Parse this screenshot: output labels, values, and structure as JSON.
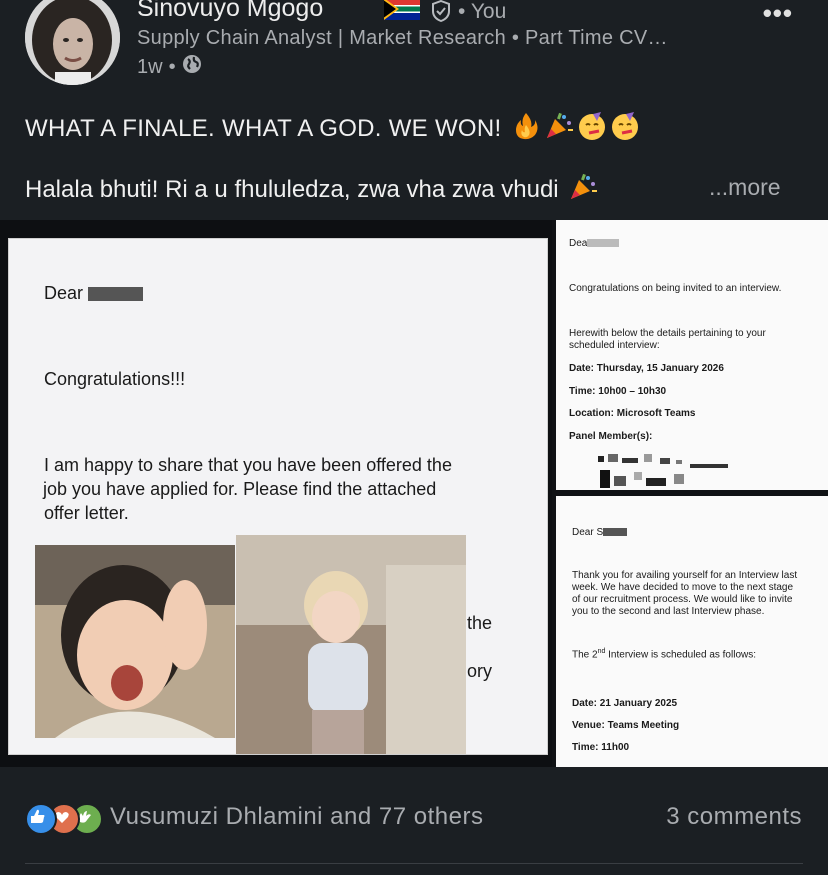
{
  "author": {
    "name": "Sinovuyo Mgogo",
    "you_label": "You",
    "headline": "Supply Chain Analyst | Market Research • Part Time CV…",
    "time": "1w",
    "visibility_icon": "globe-icon",
    "flag_icon": "south-africa-flag-icon"
  },
  "menu_label": "•••",
  "post": {
    "line1": "WHAT A FINALE. WHAT A GOD. WE WON!",
    "line2": "Halala bhuti! Ri a u fhululedza, zwa vha zwa vhudi",
    "more": "...more"
  },
  "media": {
    "left": {
      "dear": "Dear",
      "congrats": "Congratulations!!!",
      "body1": "I am happy to share that you have been offered the",
      "body2": "job you have applied for.  Please find the attached",
      "body3": "offer letter.",
      "peek1": "the",
      "peek2": "ory"
    },
    "right_top": {
      "dear": "Dea",
      "congrats": "Congratulations on being invited to an interview.",
      "herewith1": "Herewith below the details pertaining to your",
      "herewith2": "scheduled interview:",
      "date": "Date: Thursday, 15 January 2026",
      "time": "Time: 10h00 – 10h30",
      "location": "Location: Microsoft Teams",
      "panel": "Panel Member(s):"
    },
    "right_bottom": {
      "dear": "Dear S",
      "p1": "Thank you for availing yourself for an Interview last",
      "p2": "week.  We have decided to move to the next stage",
      "p3": "of our recruitment process.  We would like to invite",
      "p4": "you to the second and last Interview phase.",
      "sched_pre": "The 2",
      "sched_sup": "nd",
      "sched_post": " Interview is scheduled as follows:",
      "date": "Date: 21 January 2025",
      "venue": "Venue: Teams Meeting",
      "time": "Time: 11h00"
    }
  },
  "footer": {
    "reactions_text": "Vusumuzi Dhlamini and 77 others",
    "comments_text": "3 comments",
    "reaction_icons": [
      "like-icon",
      "love-icon",
      "celebrate-icon"
    ]
  },
  "colors": {
    "background": "#1b1f23",
    "muted_text": "#a9acb0",
    "like": "#378fe9",
    "love": "#df704d",
    "celebrate": "#6dae4f"
  }
}
